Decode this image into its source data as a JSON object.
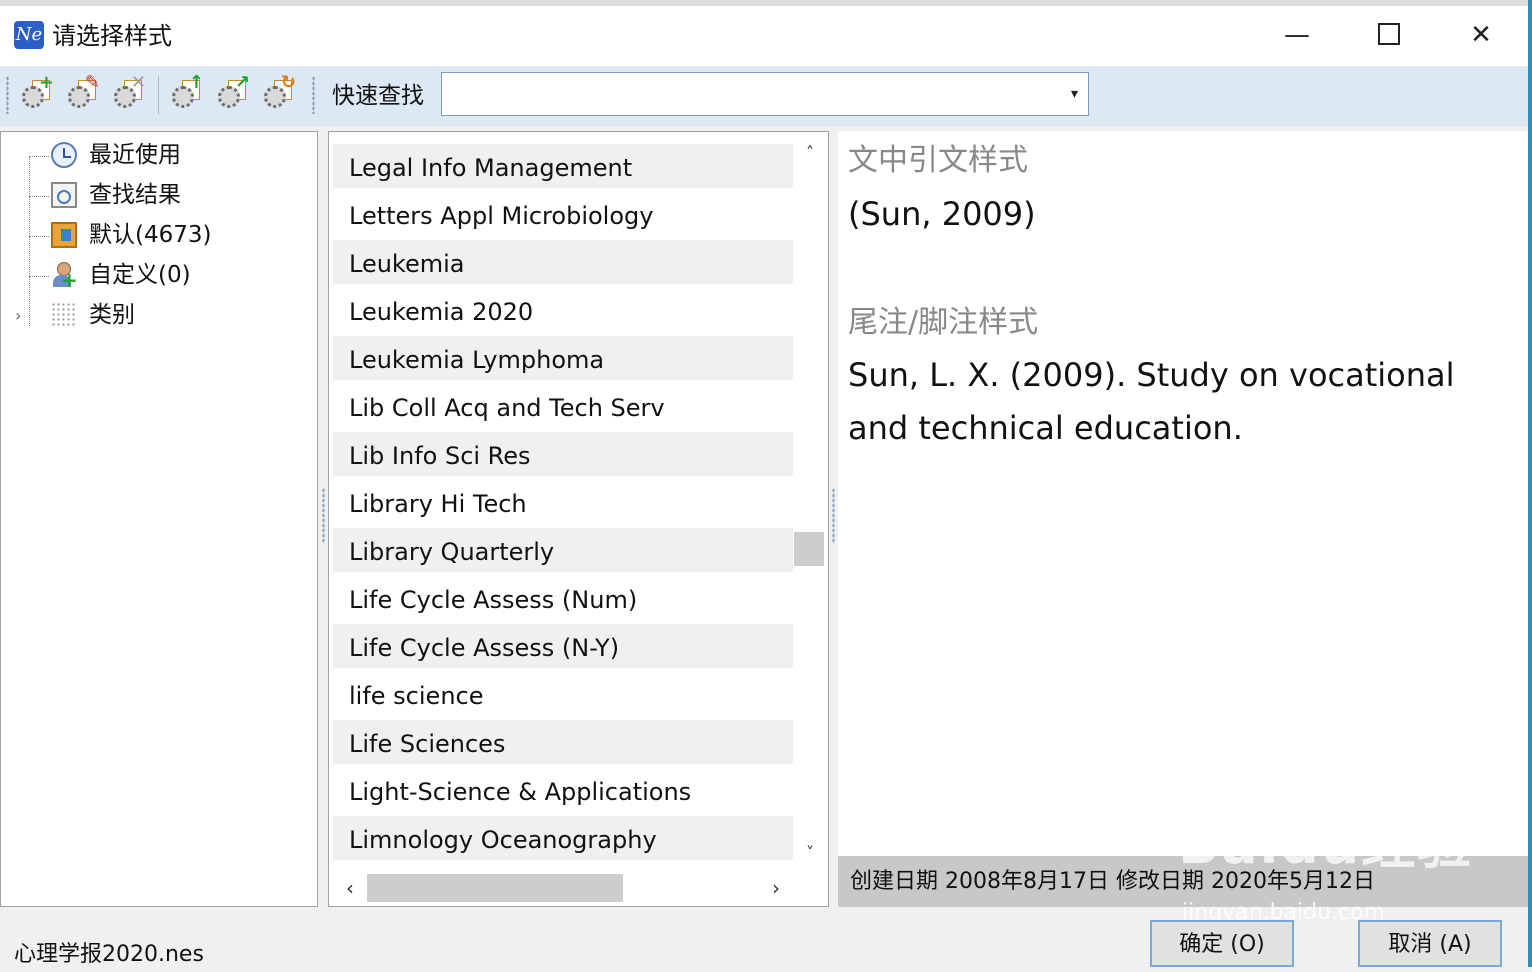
{
  "window": {
    "title": "请选择样式",
    "app_icon_text": "Ne",
    "minimize_glyph": "—",
    "close_glyph": "✕"
  },
  "toolbar": {
    "buttons": [
      {
        "name": "new-style",
        "icon": "gear-add-icon",
        "mark": "+",
        "mark_color": "#1ea42b"
      },
      {
        "name": "edit-style",
        "icon": "gear-edit-icon",
        "mark": "✎",
        "mark_color": "#c0392b"
      },
      {
        "name": "delete-style",
        "icon": "gear-delete-icon",
        "mark": "✕",
        "mark_color": "#9a9a9a"
      },
      {
        "name": "import-style",
        "icon": "gear-import-icon",
        "mark": "↑",
        "mark_color": "#1ea42b"
      },
      {
        "name": "export-style",
        "icon": "gear-export-icon",
        "mark": "↗",
        "mark_color": "#1ea42b"
      },
      {
        "name": "update-style",
        "icon": "gear-update-icon",
        "mark": "↻",
        "mark_color": "#e07b1a"
      }
    ],
    "quick_find_label": "快速查找",
    "quick_find_value": "",
    "dropdown_glyph": "▾"
  },
  "tree": {
    "items": [
      {
        "label": "最近使用",
        "icon": "clock-icon"
      },
      {
        "label": "查找结果",
        "icon": "search-results-icon"
      },
      {
        "label": "默认(4673)",
        "icon": "book-icon"
      },
      {
        "label": "自定义(0)",
        "icon": "user-add-icon"
      },
      {
        "label": "类别",
        "icon": "grid-icon",
        "expander": "›"
      }
    ]
  },
  "style_list": {
    "items": [
      "Legal Info Management",
      "Letters Appl Microbiology",
      "Leukemia",
      "Leukemia 2020",
      "Leukemia Lymphoma",
      "Lib Coll Acq and Tech Serv",
      "Lib Info Sci Res",
      "Library Hi Tech",
      "Library Quarterly",
      "Life Cycle Assess (Num)",
      "Life Cycle Assess (N-Y)",
      "life science",
      "Life Sciences",
      "Light-Science & Applications",
      "Limnology Oceanography"
    ],
    "scroll_up": "˄",
    "scroll_down": "˅",
    "scroll_left": "‹",
    "scroll_right": "›"
  },
  "preview": {
    "citation_heading": "文中引文样式",
    "citation_text": "(Sun, 2009)",
    "footnote_heading": "尾注/脚注样式",
    "footnote_text": "Sun, L. X. (2009). Study on vocational and technical education."
  },
  "status": {
    "text": "创建日期  2008年8月17日  修改日期  2020年5月12日"
  },
  "watermark": {
    "main": "Baidu经验",
    "sub": "jingyan.baidu.com"
  },
  "footer": {
    "filename": "心理学报2020.nes",
    "ok_label": "确定 (O)",
    "cancel_label": "取消 (A)"
  }
}
